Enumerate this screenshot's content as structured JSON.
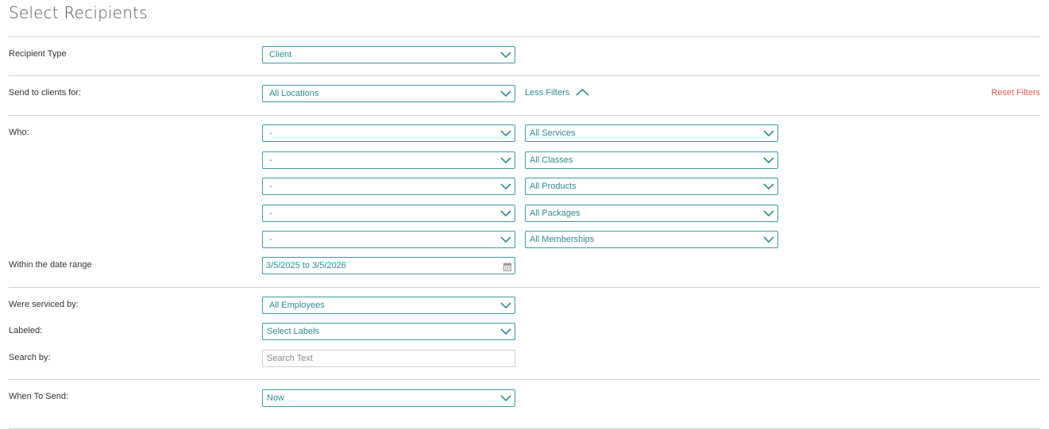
{
  "page": {
    "title": "Select Recipients"
  },
  "recipient_type": {
    "label": "Recipient Type",
    "value": "Client"
  },
  "send_to": {
    "label": "Send to clients for:",
    "value": "All Locations",
    "less_filters": "Less Filters",
    "reset_filters": "Reset Filters"
  },
  "who": {
    "label": "Who:",
    "rows": [
      {
        "left": "-",
        "right": "All Services"
      },
      {
        "left": "-",
        "right": "All Classes"
      },
      {
        "left": "-",
        "right": "All Products"
      },
      {
        "left": "-",
        "right": "All Packages"
      },
      {
        "left": "-",
        "right": "All Memberships"
      }
    ]
  },
  "date_range": {
    "label": "Within the date range",
    "value": "3/5/2025 to 3/5/2026"
  },
  "serviced_by": {
    "label": "Were serviced by:",
    "value": "All Employees"
  },
  "labeled": {
    "label": "Labeled:",
    "value": "Select Labels"
  },
  "search_by": {
    "label": "Search by:",
    "placeholder": "Search Text",
    "value": ""
  },
  "when_to_send": {
    "label": "When To Send:",
    "value": "Now"
  },
  "colors": {
    "accent": "#2e8b96",
    "border": "#3b9aa5",
    "reset": "#e05a4e",
    "divider": "#d3d3d3"
  }
}
